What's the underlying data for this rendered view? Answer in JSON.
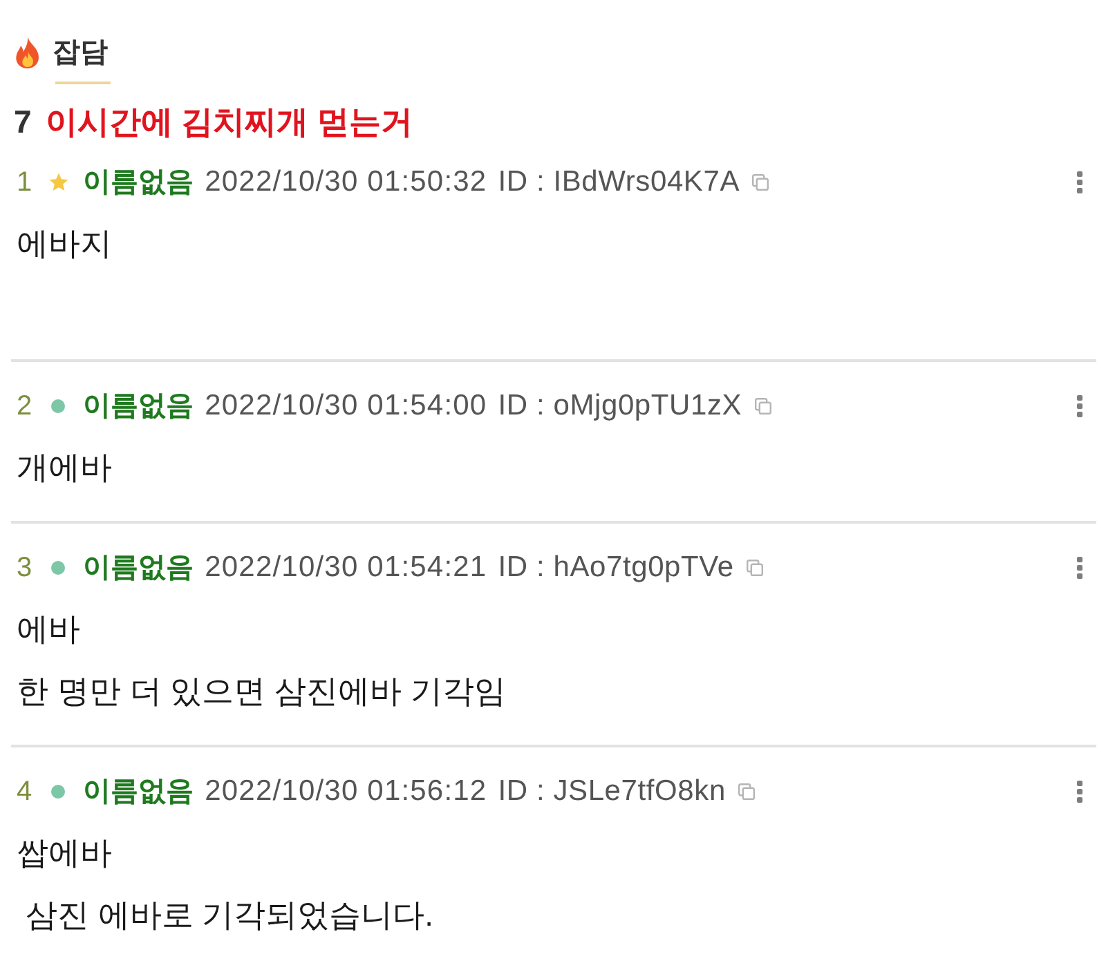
{
  "board": {
    "name": "잡담"
  },
  "thread": {
    "number": "7",
    "title": "이시간에 김치찌개 먿는거"
  },
  "posts": [
    {
      "number": "1",
      "kind": "star",
      "author": "이름없음",
      "datetime": "2022/10/30 01:50:32",
      "id_text": "ID : IBdWrs04K7A",
      "lines": [
        "에바지"
      ]
    },
    {
      "number": "2",
      "kind": "dot",
      "author": "이름없음",
      "datetime": "2022/10/30 01:54:00",
      "id_text": "ID : oMjg0pTU1zX",
      "lines": [
        "개에바"
      ]
    },
    {
      "number": "3",
      "kind": "dot",
      "author": "이름없음",
      "datetime": "2022/10/30 01:54:21",
      "id_text": "ID : hAo7tg0pTVe",
      "lines": [
        "에바",
        "한 명만 더 있으면 삼진에바 기각임"
      ]
    },
    {
      "number": "4",
      "kind": "dot",
      "author": "이름없음",
      "datetime": "2022/10/30 01:56:12",
      "id_text": "ID : JSLe7tfO8kn",
      "lines": [
        "쌉에바",
        " 삼진 에바로 기각되었습니다."
      ]
    }
  ]
}
